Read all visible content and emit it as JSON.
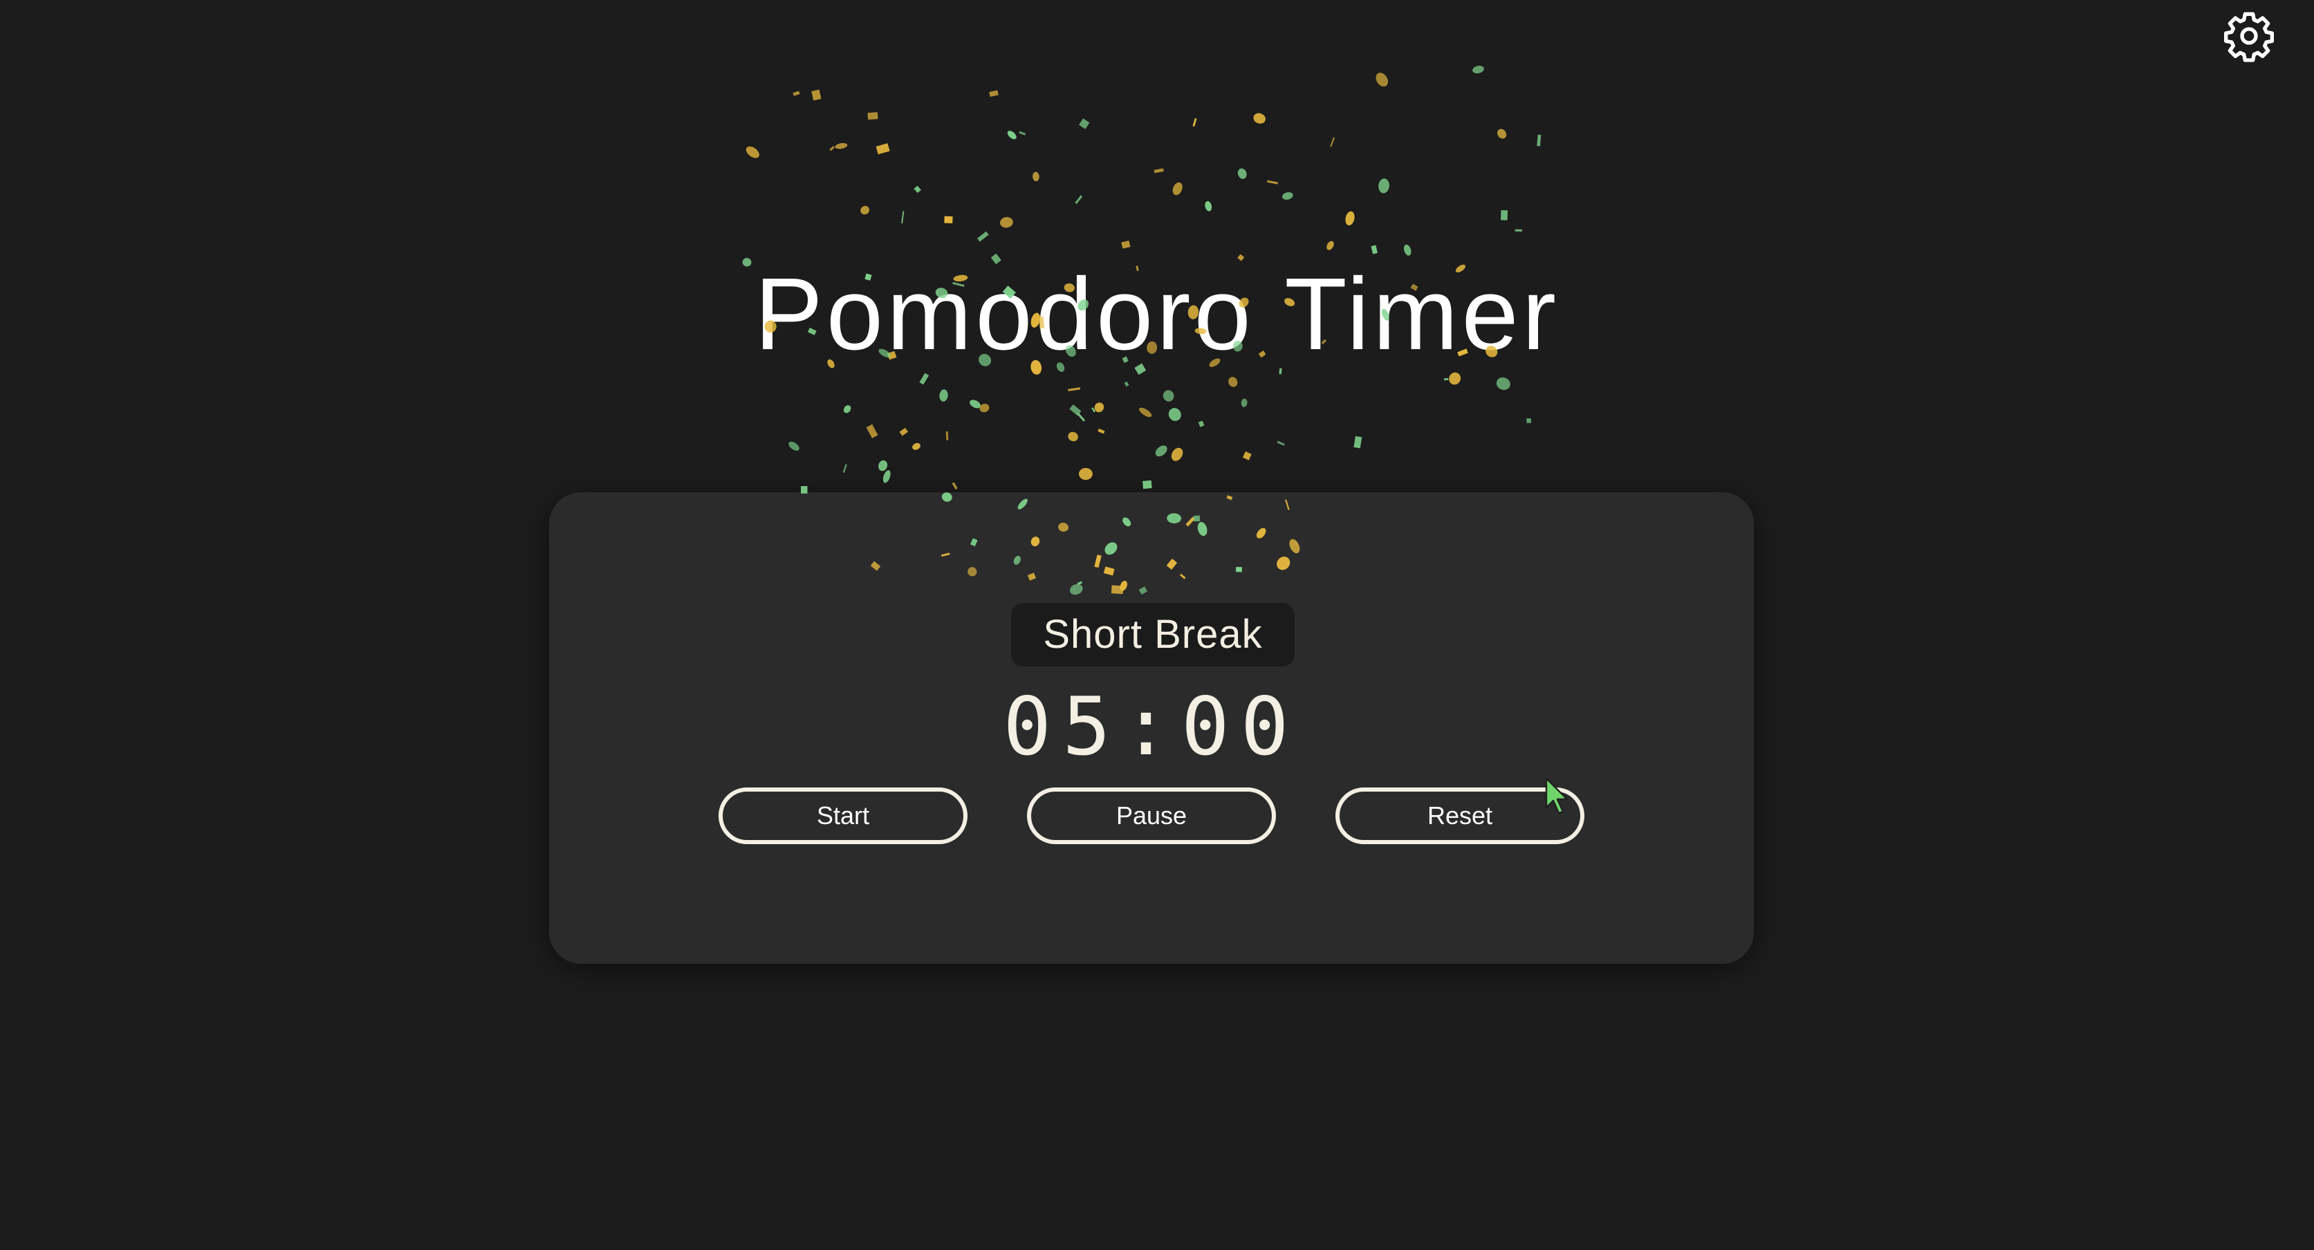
{
  "app": {
    "title": "Pomodoro Timer"
  },
  "header": {
    "settings_icon": "gear-icon"
  },
  "timer": {
    "mode": "Short Break",
    "time": "05:00"
  },
  "controls": {
    "start_label": "Start",
    "pause_label": "Pause",
    "reset_label": "Reset"
  },
  "theme": {
    "background": "#1c1c1c",
    "card": "#2b2b2b",
    "badge": "#1b1b1b",
    "text": "#f3efe3",
    "confetti_yellow": "#e8b93e",
    "confetti_green": "#7fd48c"
  }
}
